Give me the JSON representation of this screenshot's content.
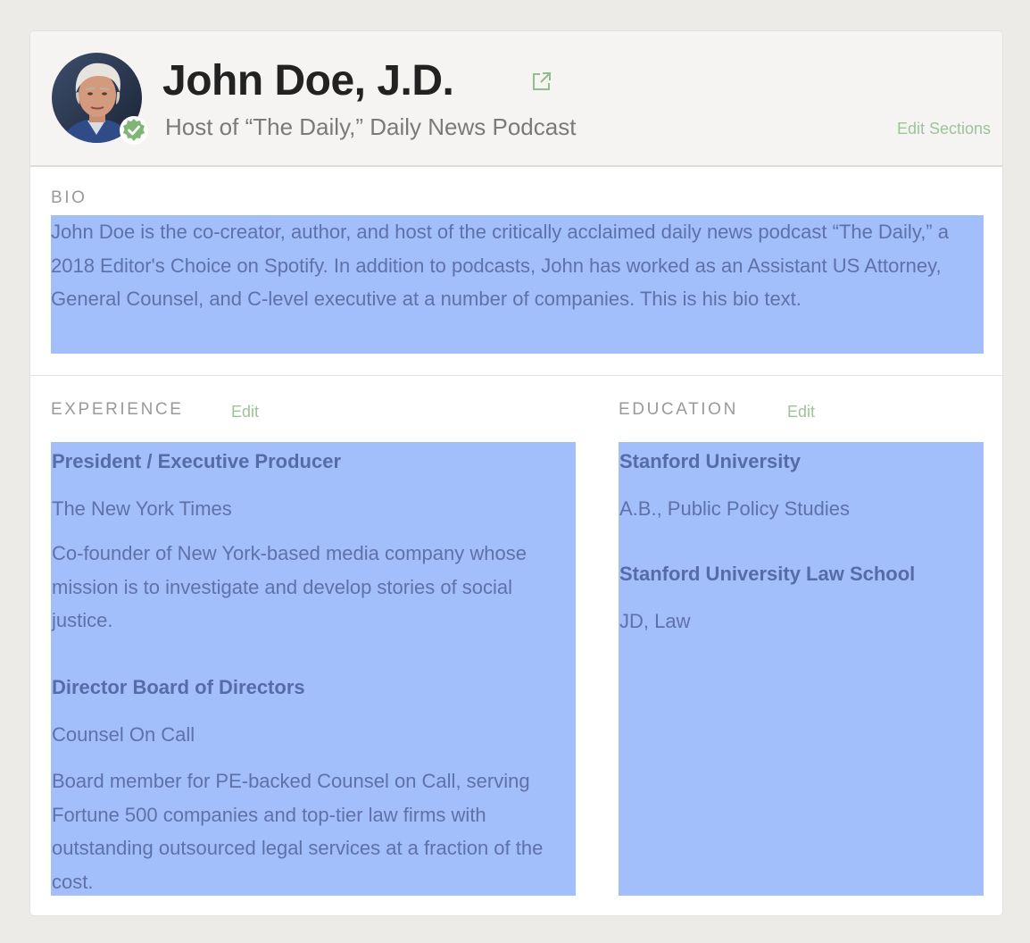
{
  "profile": {
    "name": "John Doe, J.D.",
    "subtitle": "Host of “The Daily,” Daily News Podcast",
    "edit_sections_label": "Edit Sections",
    "avatar_icon": "avatar-photo",
    "verified_icon": "verified-badge-icon",
    "external_link_icon": "external-link-icon"
  },
  "bio": {
    "label": "BIO",
    "text": "John Doe is the co-creator, author, and host of the critically acclaimed daily news podcast “The Daily,” a 2018 Editor's Choice on Spotify. In addition to podcasts, John has worked as an Assistant US Attorney, General Counsel, and C-level executive at a number of companies. This is his bio text."
  },
  "experience": {
    "label": "EXPERIENCE",
    "edit_label": "Edit",
    "items": [
      {
        "title": "President / Executive Producer",
        "organization": "The New York Times",
        "description": "Co-founder of New York-based media company whose mission is to investigate and develop stories of social justice."
      },
      {
        "title": "Director Board of Directors",
        "organization": "Counsel On Call",
        "description": "Board member for PE-backed Counsel on Call, serving Fortune 500 companies and top-tier law firms with outstanding outsourced legal services at a fraction of the cost."
      }
    ]
  },
  "education": {
    "label": "EDUCATION",
    "edit_label": "Edit",
    "items": [
      {
        "school": "Stanford University",
        "degree": "A.B., Public Policy Studies"
      },
      {
        "school": "Stanford University Law School",
        "degree": "JD, Law"
      }
    ]
  },
  "colors": {
    "accent_green": "#9bc497",
    "highlight": "#a2bffc",
    "text_primary": "#222222",
    "text_muted": "#7a7a78",
    "page_background": "#ecebe8"
  }
}
